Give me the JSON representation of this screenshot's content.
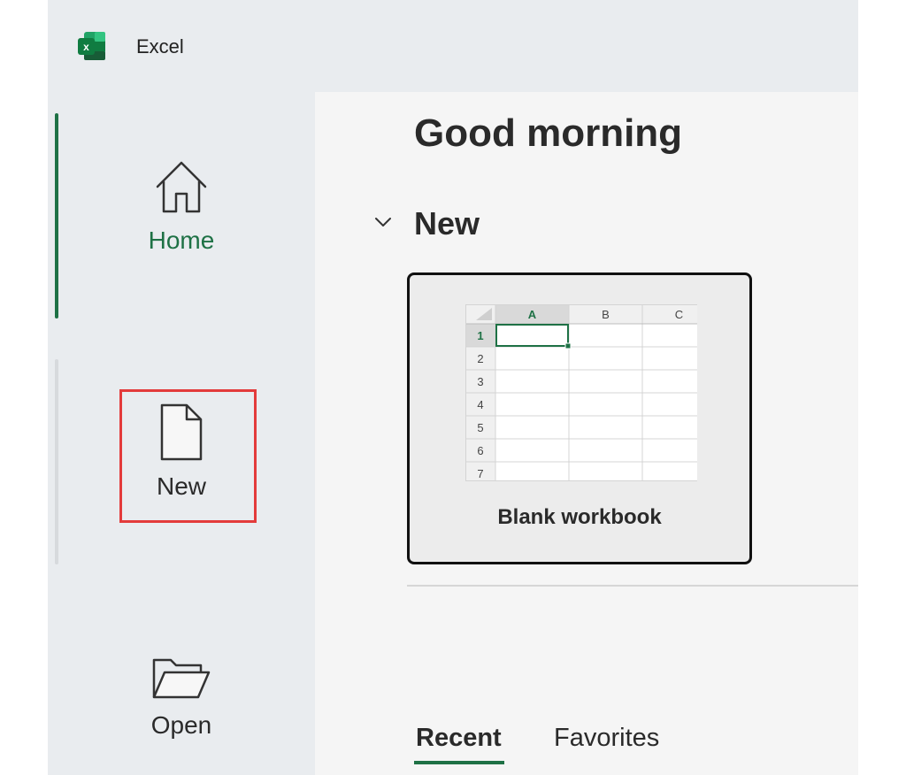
{
  "app": {
    "title": "Excel",
    "logo_icon": "excel-logo-icon",
    "logo_letter": "x",
    "accent_color": "#1e7145"
  },
  "sidebar": {
    "items": [
      {
        "label": "Home",
        "icon": "home-icon",
        "active": true
      },
      {
        "label": "New",
        "icon": "new-document-icon",
        "active": false,
        "highlighted": true
      },
      {
        "label": "Open",
        "icon": "folder-open-icon",
        "active": false
      }
    ]
  },
  "main": {
    "greeting": "Good morning",
    "section": {
      "title": "New",
      "toggle_icon": "chevron-down-icon",
      "expanded": true
    },
    "templates": [
      {
        "label": "Blank workbook",
        "preview": {
          "columns": [
            "A",
            "B",
            "C"
          ],
          "rows": [
            "1",
            "2",
            "3",
            "4",
            "5",
            "6",
            "7"
          ],
          "selected_cell": "A1"
        }
      }
    ],
    "tabs": [
      {
        "label": "Recent",
        "active": true
      },
      {
        "label": "Favorites",
        "active": false
      }
    ]
  }
}
